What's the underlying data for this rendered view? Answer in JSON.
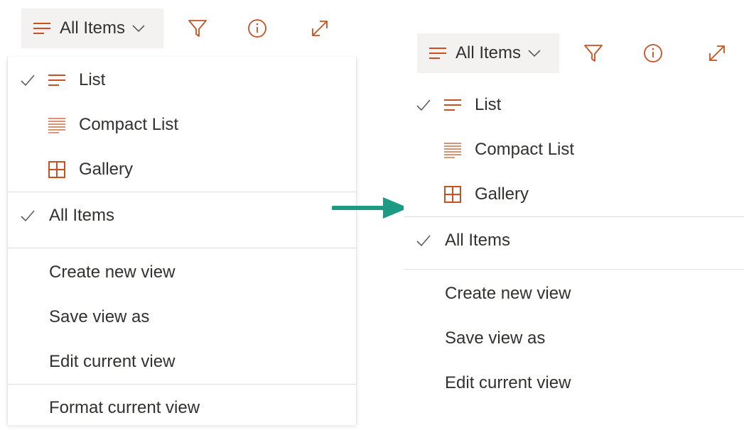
{
  "colors": {
    "accent": "#c8511f",
    "arrow": "#1d9a84",
    "text": "#323130",
    "icon_gray": "#605e5c"
  },
  "left": {
    "toolbar": {
      "view_label": "All Items",
      "icons": [
        "view-lines-icon",
        "chevron-down-icon",
        "filter-icon",
        "info-icon",
        "expand-icon"
      ]
    },
    "menu": {
      "layout_items": [
        {
          "label": "List",
          "icon": "list-icon",
          "checked": true
        },
        {
          "label": "Compact List",
          "icon": "compact-list-icon",
          "checked": false
        },
        {
          "label": "Gallery",
          "icon": "gallery-grid-icon",
          "checked": false
        }
      ],
      "view_items": [
        {
          "label": "All Items",
          "checked": true
        }
      ],
      "actions": [
        {
          "label": "Create new view"
        },
        {
          "label": "Save view as"
        },
        {
          "label": "Edit current view"
        }
      ],
      "format": {
        "label": "Format current view"
      }
    }
  },
  "right": {
    "toolbar": {
      "view_label": "All Items",
      "icons": [
        "view-lines-icon",
        "chevron-down-icon",
        "filter-icon",
        "info-icon",
        "expand-icon"
      ]
    },
    "menu": {
      "layout_items": [
        {
          "label": "List",
          "icon": "list-icon",
          "checked": true
        },
        {
          "label": "Compact List",
          "icon": "compact-list-icon",
          "checked": false
        },
        {
          "label": "Gallery",
          "icon": "gallery-grid-icon",
          "checked": false
        }
      ],
      "view_items": [
        {
          "label": "All Items",
          "checked": true
        }
      ],
      "actions": [
        {
          "label": "Create new view"
        },
        {
          "label": "Save view as"
        },
        {
          "label": "Edit current view"
        }
      ]
    }
  },
  "arrow_icon": "right-arrow-icon"
}
